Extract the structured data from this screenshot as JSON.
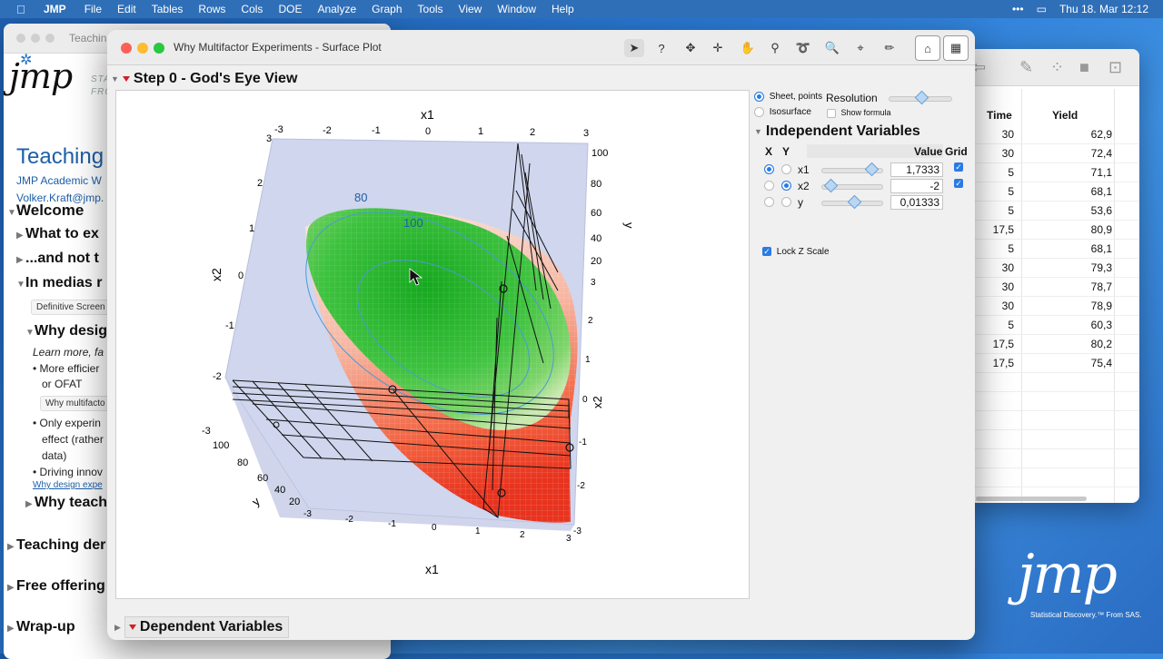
{
  "menubar": {
    "app": "JMP",
    "items": [
      "File",
      "Edit",
      "Tables",
      "Rows",
      "Cols",
      "DOE",
      "Analyze",
      "Graph",
      "Tools",
      "View",
      "Window",
      "Help"
    ],
    "clock": "Thu 18. Mar  12:12"
  },
  "journal": {
    "title": "Teachin",
    "logo": "jmp",
    "stat_line1": "STA",
    "stat_line2": "FRO",
    "heading": "Teaching",
    "sub1": "JMP Academic W",
    "sub2": "Volker.Kraft@jmp.",
    "outline": [
      {
        "label": "Welcome"
      },
      {
        "label": "What to ex"
      },
      {
        "label": "...and not t"
      },
      {
        "label": "In medias r"
      }
    ],
    "definitive_btn": "Definitive Screen",
    "why_design": "Why desig",
    "learn_more": "Learn more, fa",
    "bullets": [
      "• More efficier",
      "or OFAT",
      "• Only experin",
      "effect (rather",
      "data)",
      "• Driving innov"
    ],
    "why_multifactor_btn": "Why multifacto",
    "link": "Why design expe",
    "why_teach": "Why teach",
    "bottom_sections": [
      "Teaching der",
      "Free offering",
      "Wrap-up"
    ]
  },
  "datatable": {
    "columns": [
      "Time",
      "Yield"
    ],
    "rows": [
      [
        "30",
        "62,9"
      ],
      [
        "30",
        "72,4"
      ],
      [
        "5",
        "71,1"
      ],
      [
        "5",
        "68,1"
      ],
      [
        "5",
        "53,6"
      ],
      [
        "17,5",
        "80,9"
      ],
      [
        "5",
        "68,1"
      ],
      [
        "30",
        "79,3"
      ],
      [
        "30",
        "78,7"
      ],
      [
        "30",
        "78,9"
      ],
      [
        "5",
        "60,3"
      ],
      [
        "17,5",
        "80,2"
      ],
      [
        "17,5",
        "75,4"
      ]
    ]
  },
  "window": {
    "title": "Why Multifactor Experiments - Surface Plot",
    "step_title": "Step 0 - God's Eye View",
    "dependent_title": "Dependent Variables"
  },
  "controls": {
    "sheet_points": "Sheet, points",
    "isosurface": "Isosurface",
    "resolution": "Resolution",
    "show_formula": "Show formula",
    "resolution_level": 0.5,
    "indep_title": "Independent Variables",
    "col_x": "X",
    "col_y": "Y",
    "col_value": "Value",
    "col_grid": "Grid",
    "vars": [
      {
        "name": "x1",
        "value": "1,7333",
        "slider": 0.87,
        "x": true,
        "y": false,
        "grid": true
      },
      {
        "name": "x2",
        "value": "-2",
        "slider": 0.0,
        "x": false,
        "y": true,
        "grid": true
      },
      {
        "name": "y",
        "value": "0,01333",
        "slider": 0.5,
        "x": false,
        "y": false,
        "grid": false
      }
    ],
    "lock_z": "Lock Z Scale"
  },
  "plot": {
    "top_axis_title": "x1",
    "top_ticks": [
      "-3",
      "-2",
      "-1",
      "0",
      "1",
      "2",
      "3"
    ],
    "left_axis_title": "x2",
    "left_ticks": [
      "3",
      "2",
      "1",
      "0",
      "-1",
      "-2",
      "-3"
    ],
    "right_y_title": "y",
    "right_y_ticks": [
      "100",
      "80",
      "60",
      "40",
      "20",
      "3"
    ],
    "right_x2_title": "x2",
    "right_x2_ticks": [
      "2",
      "1",
      "0",
      "-1",
      "-2",
      "-3"
    ],
    "bottom_axis_title": "x1",
    "bottom_ticks": [
      "-3",
      "-2",
      "-1",
      "0",
      "1",
      "2",
      "3"
    ],
    "bottom_y_title": "y",
    "bottom_y_ticks": [
      "100",
      "80",
      "60",
      "40",
      "20"
    ],
    "contour_labels": [
      "80",
      "100"
    ],
    "colors": {
      "high": "#1fb82a",
      "low": "#f04a2e",
      "backplane": "#cfd6ee"
    }
  },
  "brand": {
    "logo": "jmp",
    "tagline": "Statistical Discovery.™ From SAS."
  }
}
